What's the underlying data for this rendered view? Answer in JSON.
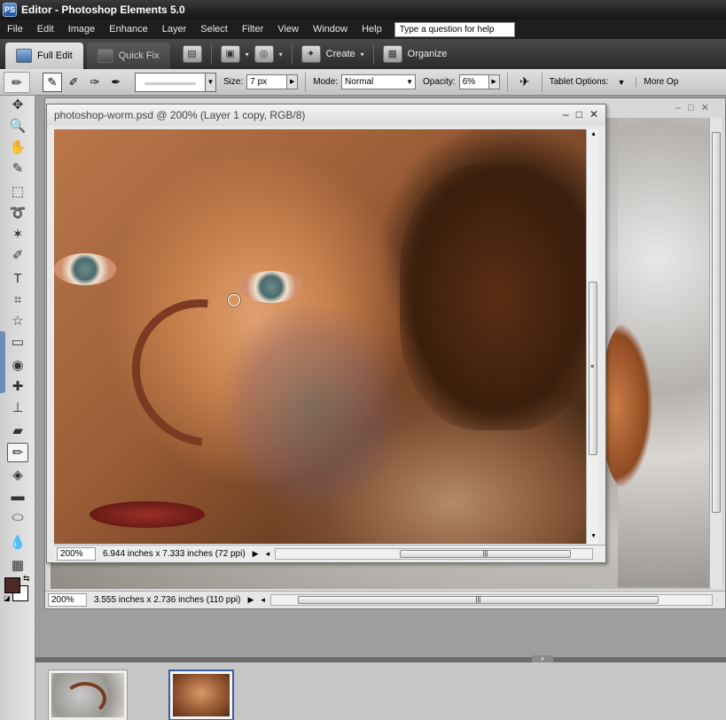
{
  "window": {
    "title": "Editor - Photoshop Elements 5.0",
    "app_icon": "PS",
    "controls": {
      "minimize": "–",
      "maximize": "□",
      "close": "✕"
    }
  },
  "menubar": {
    "items": [
      "File",
      "Edit",
      "Image",
      "Enhance",
      "Layer",
      "Select",
      "Filter",
      "View",
      "Window",
      "Help"
    ],
    "help_placeholder": "Type a question for help"
  },
  "tabs": {
    "full_edit": "Full Edit",
    "quick_fix": "Quick Fix"
  },
  "shortcuts": {
    "create": "Create",
    "organize": "Organize",
    "create_arrow": "▾",
    "print_icon": "print-icon",
    "photo_icon": "photo-project-icon",
    "share_icon": "share-icon"
  },
  "options": {
    "size_label": "Size:",
    "size_value": "7 px",
    "mode_label": "Mode:",
    "mode_value": "Normal",
    "opacity_label": "Opacity:",
    "opacity_value": "6%",
    "tablet_label": "Tablet Options:",
    "more_label": "More Op"
  },
  "toolbox": {
    "tools": [
      {
        "name": "move-tool-icon",
        "glyph": "✥",
        "active": false
      },
      {
        "name": "zoom-tool-icon",
        "glyph": "🔍",
        "active": false
      },
      {
        "name": "hand-tool-icon",
        "glyph": "✋",
        "active": false
      },
      {
        "name": "eyedropper-tool-icon",
        "glyph": "✎",
        "active": false
      },
      {
        "name": "marquee-tool-icon",
        "glyph": "⬚",
        "active": false
      },
      {
        "name": "lasso-tool-icon",
        "glyph": "➰",
        "active": false
      },
      {
        "name": "magic-wand-tool-icon",
        "glyph": "✶",
        "active": false
      },
      {
        "name": "selection-brush-tool-icon",
        "glyph": "✐",
        "active": false
      },
      {
        "name": "type-tool-icon",
        "glyph": "T",
        "active": false
      },
      {
        "name": "crop-tool-icon",
        "glyph": "⌗",
        "active": false
      },
      {
        "name": "cookie-cutter-tool-icon",
        "glyph": "☆",
        "active": false
      },
      {
        "name": "straighten-tool-icon",
        "glyph": "▭",
        "active": false
      },
      {
        "name": "red-eye-tool-icon",
        "glyph": "◉",
        "active": false
      },
      {
        "name": "healing-brush-tool-icon",
        "glyph": "✚",
        "active": false
      },
      {
        "name": "clone-stamp-tool-icon",
        "glyph": "⊥",
        "active": false
      },
      {
        "name": "eraser-tool-icon",
        "glyph": "▰",
        "active": false
      },
      {
        "name": "brush-tool-icon",
        "glyph": "✏",
        "active": true
      },
      {
        "name": "paint-bucket-tool-icon",
        "glyph": "◈",
        "active": false
      },
      {
        "name": "gradient-tool-icon",
        "glyph": "▬",
        "active": false
      },
      {
        "name": "shape-tool-icon",
        "glyph": "⬭",
        "active": false
      },
      {
        "name": "blur-tool-icon",
        "glyph": "💧",
        "active": false
      },
      {
        "name": "sponge-tool-icon",
        "glyph": "▦",
        "active": false
      }
    ],
    "foreground_color": "#4a2a25",
    "background_color": "#ffffff"
  },
  "front_doc": {
    "title": "photoshop-worm.psd @ 200% (Layer 1 copy, RGB/8)",
    "zoom": "200%",
    "info": "6.944 inches x 7.333 inches (72 ppi)"
  },
  "back_doc": {
    "zoom": "200%",
    "info": "3.555 inches x 2.736 inches (110 ppi)"
  },
  "bin": {
    "thumbnails": [
      "worm-thumbnail",
      "portrait-thumbnail"
    ]
  }
}
